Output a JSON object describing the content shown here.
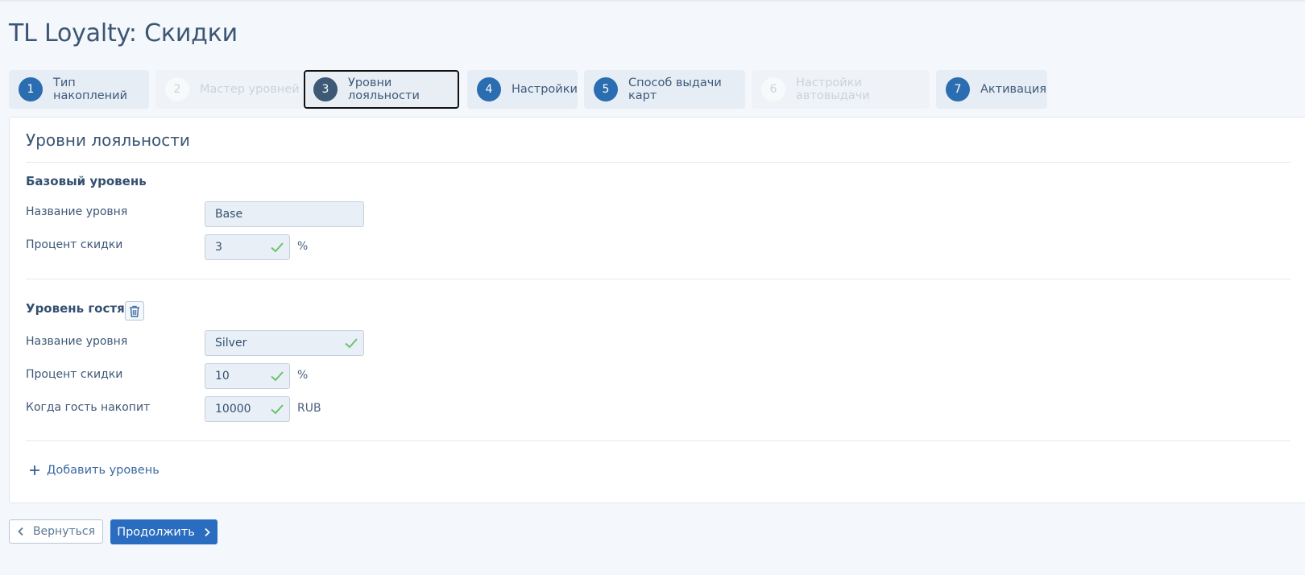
{
  "page": {
    "title": "TL Loyalty: Скидки"
  },
  "steps": [
    {
      "num": "1",
      "label": "Тип накоплений",
      "state": "done"
    },
    {
      "num": "2",
      "label": "Мастер уровней",
      "state": "disabled"
    },
    {
      "num": "3",
      "label": "Уровни лояльности",
      "state": "active"
    },
    {
      "num": "4",
      "label": "Настройки",
      "state": "done"
    },
    {
      "num": "5",
      "label": "Способ выдачи карт",
      "state": "done"
    },
    {
      "num": "6",
      "label": "Настройки автовыдачи",
      "state": "disabled"
    },
    {
      "num": "7",
      "label": "Активация",
      "state": "done"
    }
  ],
  "card": {
    "title": "Уровни лояльности",
    "base_level": {
      "heading": "Базовый уровень",
      "name_label": "Название уровня",
      "name_value": "Base",
      "discount_label": "Процент скидки",
      "discount_value": "3",
      "discount_unit": "%"
    },
    "guest_level": {
      "heading": "Уровень гостя",
      "name_label": "Название уровня",
      "name_value": "Silver",
      "discount_label": "Процент скидки",
      "discount_value": "10",
      "discount_unit": "%",
      "accumulate_label": "Когда гость накопит",
      "accumulate_value": "10000",
      "accumulate_unit": "RUB"
    },
    "add_level_label": "Добавить уровень"
  },
  "footer": {
    "back_label": "Вернуться",
    "next_label": "Продолжить"
  },
  "colors": {
    "accent": "#2a6db0",
    "primary_button": "#2a6cc0",
    "check": "#6cc26c",
    "background": "#f4f7fb"
  },
  "icons": {
    "valid": "check-icon",
    "delete": "trash-icon",
    "add": "plus-icon",
    "back": "chevron-left-icon",
    "next": "chevron-right-icon"
  }
}
